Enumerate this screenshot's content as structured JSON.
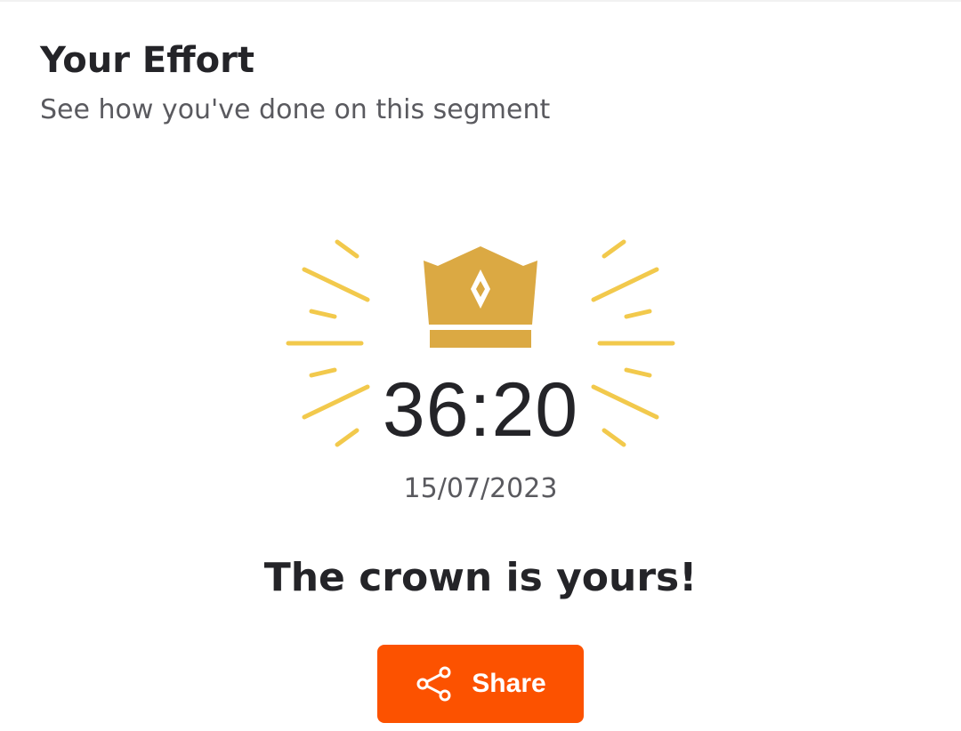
{
  "header": {
    "title": "Your Effort",
    "subtitle": "See how you've done on this segment"
  },
  "effort": {
    "time": "36:20",
    "date": "15/07/2023",
    "message": "The crown is yours!"
  },
  "actions": {
    "share_label": "Share"
  },
  "icons": {
    "crown": "crown-icon",
    "rays": "celebration-rays",
    "share": "share-icon"
  },
  "colors": {
    "accent": "#fc5200",
    "crown": "#dba943",
    "rays": "#f2c94c",
    "text_primary": "#242428",
    "text_secondary": "#5a5a5f"
  }
}
